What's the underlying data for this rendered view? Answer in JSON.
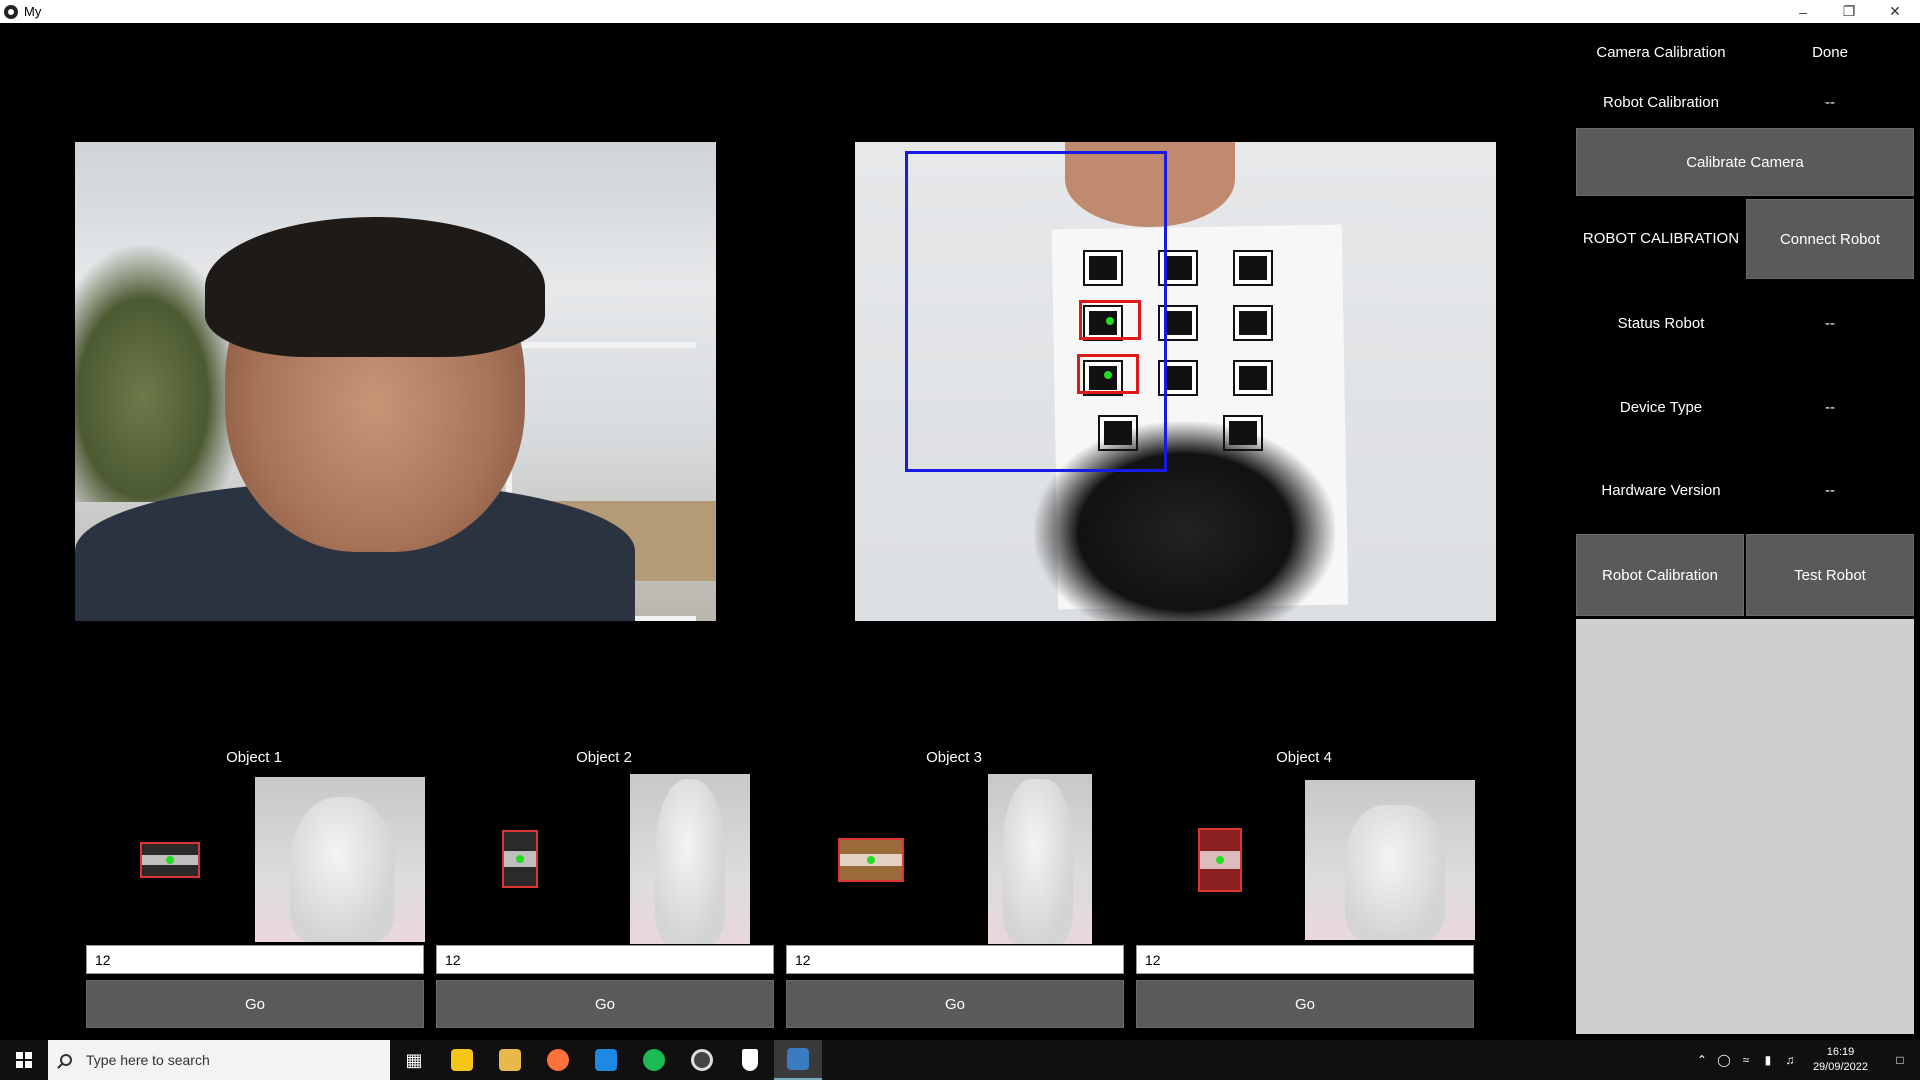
{
  "window": {
    "title": "My"
  },
  "panel": {
    "camera_calibration_label": "Camera Calibration",
    "camera_calibration_value": "Done",
    "robot_calibration_label": "Robot Calibration",
    "robot_calibration_value": "--",
    "calibrate_camera_button": "Calibrate Camera",
    "robot_calibration_heading": "ROBOT CALIBRATION",
    "connect_robot_button": "Connect Robot",
    "status_robot_label": "Status Robot",
    "status_robot_value": "--",
    "device_type_label": "Device Type",
    "device_type_value": "--",
    "hardware_version_label": "Hardware Version",
    "hardware_version_value": "--",
    "robot_calibration_button": "Robot Calibration",
    "test_robot_button": "Test Robot"
  },
  "objects": [
    {
      "title": "Object 1",
      "input_value": "12",
      "go_label": "Go"
    },
    {
      "title": "Object 2",
      "input_value": "12",
      "go_label": "Go"
    },
    {
      "title": "Object 3",
      "input_value": "12",
      "go_label": "Go"
    },
    {
      "title": "Object 4",
      "input_value": "12",
      "go_label": "Go"
    }
  ],
  "taskbar": {
    "search_placeholder": "Type here to search",
    "time": "16:19",
    "date": "29/09/2022"
  },
  "colors": {
    "button_bg": "#5a5a5a",
    "roi_box": "#1a1ae6",
    "detection_box": "#e01818",
    "centroid": "#22dd22"
  },
  "icons": [
    "app-icon",
    "windows-start-icon",
    "search-icon",
    "task-view-icon",
    "sticky-notes-icon",
    "file-explorer-icon",
    "firefox-icon",
    "vscode-icon",
    "spotify-icon",
    "chrome-icon",
    "security-icon",
    "python-icon"
  ]
}
